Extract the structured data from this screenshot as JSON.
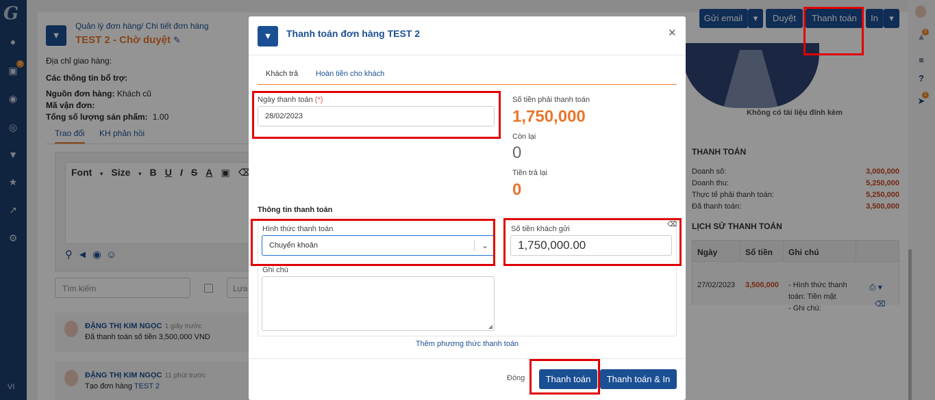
{
  "rail": {
    "badge_orders": "3",
    "lang": "VI"
  },
  "rrail": {
    "badge_notify": "3",
    "badge_rocket": "2"
  },
  "header": {
    "breadcrumb": "Quản lý đơn hàng/ Chi tiết đơn hàng",
    "title": "TEST 2 - Chờ duyệt",
    "buttons": {
      "email": "Gửi email",
      "approve": "Duyệt",
      "pay": "Thanh toán",
      "print": "In"
    }
  },
  "order_info": {
    "address_label": "Địa chỉ giao hàng:",
    "extra_label": "Các thông tin bổ trợ:",
    "source_label": "Nguồn đơn hàng:",
    "source_value": "Khách cũ",
    "shipping_label": "Mã vận đơn:",
    "qty_label": "Tổng số lượng sản phẩm:",
    "qty_value": "1.00"
  },
  "left_tabs": [
    "Trao đổi",
    "KH phản hồi"
  ],
  "editor": {
    "font_label": "Font",
    "size_label": "Size"
  },
  "search_placeholder": "Tìm kiếm",
  "filter_placeholder": "Lựa c",
  "feed": [
    {
      "name": "ĐẶNG THỊ KIM NGỌC",
      "time": "1 giây trước",
      "text": "Đã thanh toán số tiền 3,500,000 VND",
      "link": ""
    },
    {
      "name": "ĐẶNG THỊ KIM NGỌC",
      "time": "11 phút trước",
      "text": "Tạo đơn hàng ",
      "link": "TEST 2"
    }
  ],
  "attachments": {
    "empty_text": "Không có tài liệu đính kèm"
  },
  "payment_summary": {
    "title": "THANH TOÁN",
    "rows": [
      {
        "label": "Doanh số:",
        "value": "3,000,000"
      },
      {
        "label": "Doanh thu:",
        "value": "5,250,000"
      },
      {
        "label": "Thực tế phải thanh toán:",
        "value": "5,250,000"
      },
      {
        "label": "Đã thanh toán:",
        "value": "3,500,000"
      }
    ]
  },
  "history": {
    "title": "LỊCH SỬ THANH TOÁN",
    "columns": [
      "Ngày",
      "Số tiền",
      "Ghi chú"
    ],
    "rows": [
      {
        "date": "27/02/2023",
        "amount": "3,500,000",
        "note1": "- Hình thức thanh",
        "note2": "toán: Tiền mặt",
        "note3": "- Ghi chú:"
      }
    ]
  },
  "modal": {
    "title": "Thanh toán đơn hàng TEST 2",
    "tabs": [
      "Khách trả",
      "Hoàn tiền cho khách"
    ],
    "date_label": "Ngày thanh toán",
    "required_mark": "(*)",
    "date_value": "28/02/2023",
    "due_label": "Số tiền phải thanh toán",
    "due_value": "1,750,000",
    "remaining_label": "Còn lại",
    "remaining_value": "0",
    "change_label": "Tiền trả lại",
    "change_value": "0",
    "section_title": "Thông tin thanh toán",
    "method_label": "Hình thức thanh toán",
    "method_value": "Chuyển khoản",
    "amount_label": "Số tiền khách gửi",
    "amount_value": "1,750,000.00",
    "note_label": "Ghi chú",
    "add_method": "Thêm phương thức thanh toán",
    "close_label": "Đóng",
    "pay_button": "Thanh toán",
    "pay_print_button": "Thanh toán & In"
  },
  "colors": {
    "primary": "#1b4f93",
    "accent": "#e8762c",
    "highlight": "#e10000"
  }
}
